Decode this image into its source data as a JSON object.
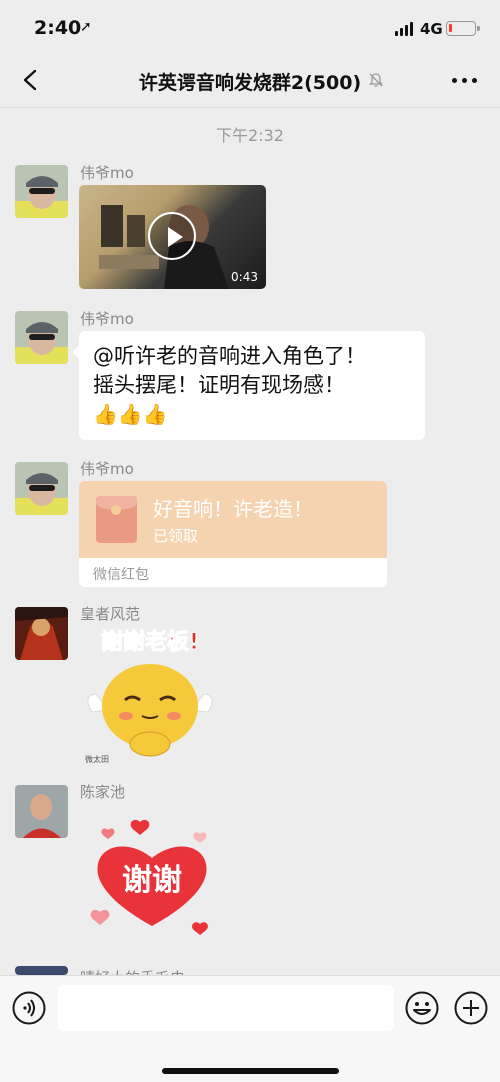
{
  "status_bar": {
    "time": "2:40",
    "network": "4G",
    "battery_level": 0.12,
    "battery_color": "#ff3b30"
  },
  "header": {
    "title": "许英谔音响发烧群2(500)",
    "icons": [
      "back-icon",
      "mute-icon",
      "more-icon"
    ]
  },
  "chat": {
    "timestamp": "下午2:32",
    "messages": [
      {
        "type": "video",
        "sender": "伟爷mo",
        "duration": "0:43"
      },
      {
        "type": "text",
        "sender": "伟爷mo",
        "line1": "@听许老的音响进入角色了！",
        "line2": "摇头摆尾！证明有现场感！",
        "emoji": "👍👍👍"
      },
      {
        "type": "red_packet",
        "sender": "伟爷mo",
        "title": "好音响！许老造！",
        "status": "已领取",
        "label": "微信红包"
      },
      {
        "type": "sticker",
        "sender": "皇者风范",
        "caption": "謝謝老板!",
        "watermark": "微太田"
      },
      {
        "type": "sticker",
        "sender": "陈家池",
        "caption": "谢谢"
      },
      {
        "type": "partial",
        "sender": "晴好大的手毛虫"
      }
    ]
  },
  "input_bar": {
    "placeholder": "",
    "icons": [
      "voice-icon",
      "emoji-icon",
      "plus-icon"
    ]
  },
  "colors": {
    "background": "#ededed",
    "red_packet": "#f6d3b0",
    "accent_red": "#e8333a"
  }
}
